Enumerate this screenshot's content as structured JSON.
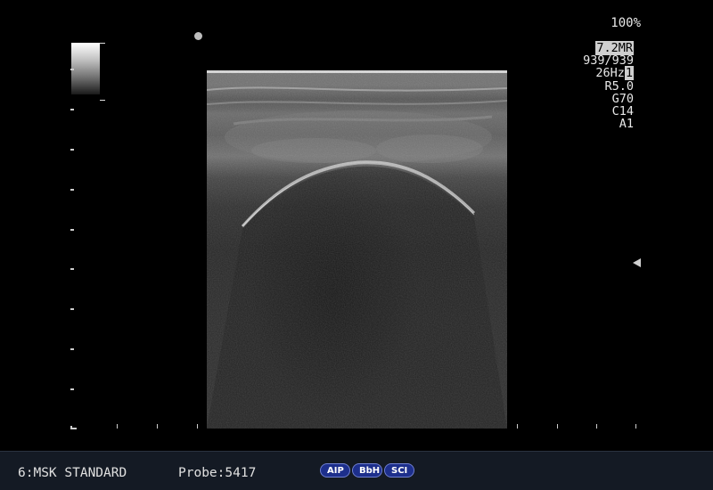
{
  "header": {
    "zoom": "100%"
  },
  "parameters": {
    "frequency": "7.2MR",
    "frequency_main": "7.2",
    "frequency_suffix": "MR",
    "frame_counter": "939/939",
    "frame_rate_value": "26Hz",
    "frame_rate_index": "1",
    "lines": [
      "R5.0",
      "G70",
      "C14",
      "A1"
    ]
  },
  "status_bar": {
    "preset": "6:MSK STANDARD",
    "probe": "Probe:5417",
    "badges": [
      "AIP",
      "BbH",
      "SCI"
    ]
  },
  "colors": {
    "status_bar_bg": "#141a24",
    "badge_bg": "#1d2f8c",
    "badge_border": "#6f7fd0",
    "text": "#e8e8e8"
  },
  "icons": {
    "orientation_marker": "orientation-dot-icon",
    "focus_marker": "focus-triangle-icon"
  }
}
